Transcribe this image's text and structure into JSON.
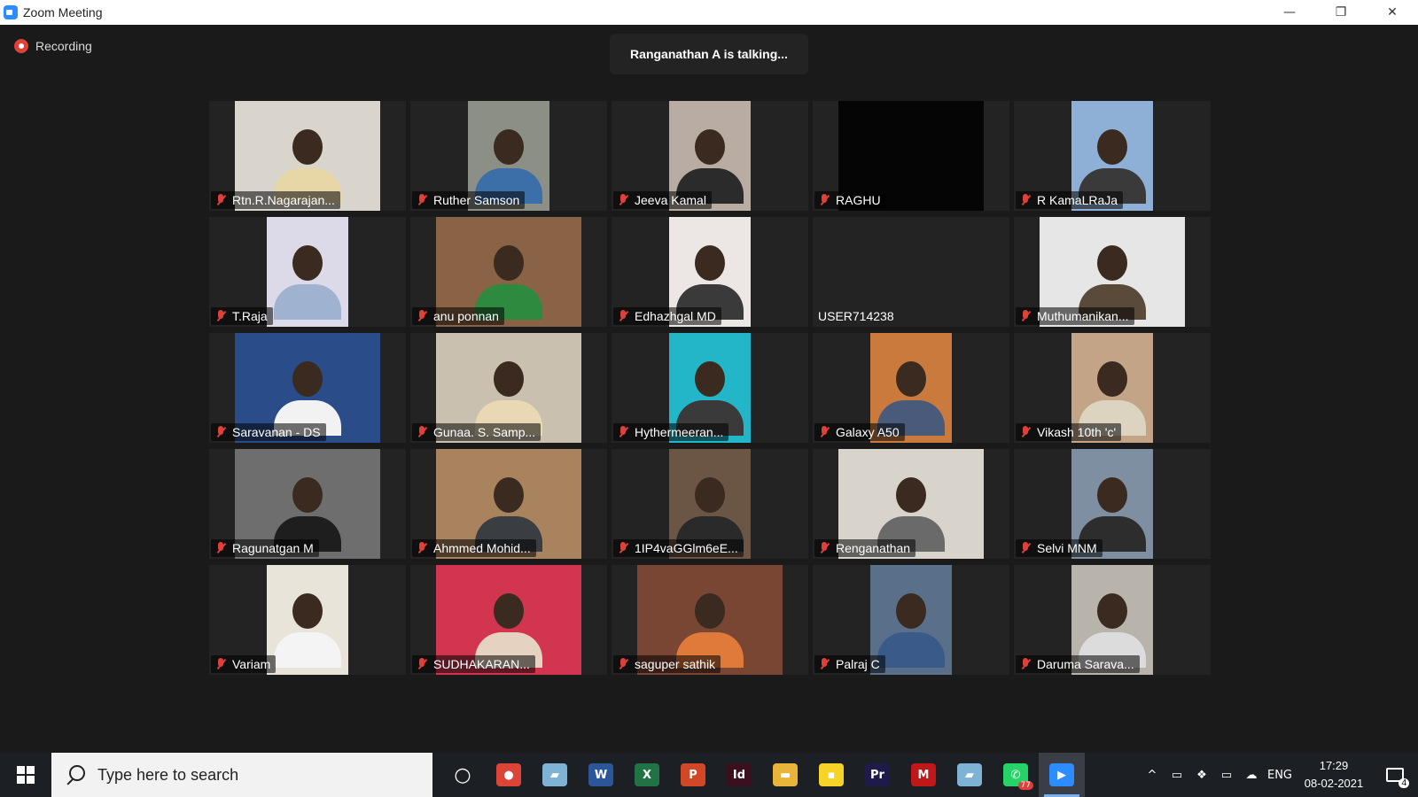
{
  "window": {
    "title": "Zoom Meeting",
    "minimize_glyph": "—",
    "restore_glyph": "❐",
    "close_glyph": "✕"
  },
  "meeting": {
    "recording_label": "Recording",
    "talking_banner": "Ranganathan A is talking...",
    "participants": [
      {
        "name": "Rtn.R.Nagarajan...",
        "muted": true,
        "video_bg": "#d9d4cc",
        "shirt": "#e8d7a6"
      },
      {
        "name": "Ruther Samson",
        "muted": true,
        "video_bg": "#8c8f86",
        "shirt": "#3c6fa8"
      },
      {
        "name": "Jeeva Kamal",
        "muted": true,
        "video_bg": "#b8aca3",
        "shirt": "#2b2b2b"
      },
      {
        "name": "RAGHU",
        "muted": true,
        "video_bg": "#050505",
        "shirt": "#1a1a1a"
      },
      {
        "name": "R KamaLRaJa",
        "muted": true,
        "video_bg": "#8fb0d6",
        "shirt": "#3a3a3a"
      },
      {
        "name": "T.Raja",
        "muted": true,
        "video_bg": "#dcd9e8",
        "shirt": "#9fb2d0"
      },
      {
        "name": "anu ponnan",
        "muted": true,
        "video_bg": "#8a6246",
        "shirt": "#2d8a3f"
      },
      {
        "name": "Edhazhgal MD",
        "muted": true,
        "video_bg": "#ece7e5",
        "shirt": "#3a3a3a"
      },
      {
        "name": "USER714238",
        "muted": false,
        "video_bg": "#232323",
        "shirt": "#232323"
      },
      {
        "name": "Muthumanikan...",
        "muted": true,
        "video_bg": "#e6e6e6",
        "shirt": "#5a4a3a"
      },
      {
        "name": "Saravanan - DS",
        "muted": true,
        "video_bg": "#2a4d8a",
        "shirt": "#f2f2f2"
      },
      {
        "name": "Gunaa. S. Samp...",
        "muted": true,
        "video_bg": "#c9c0b0",
        "shirt": "#e8d9b4"
      },
      {
        "name": "Hythermeeran...",
        "muted": true,
        "video_bg": "#23b6c9",
        "shirt": "#3a3a3a"
      },
      {
        "name": "Galaxy A50",
        "muted": true,
        "video_bg": "#c97a3c",
        "shirt": "#4a5a7a"
      },
      {
        "name": "Vikash 10th 'c'",
        "muted": true,
        "video_bg": "#c4a486",
        "shirt": "#dcd3c0"
      },
      {
        "name": "Ragunatgan M",
        "muted": true,
        "video_bg": "#6e6e6e",
        "shirt": "#1e1e1e"
      },
      {
        "name": "Ahmmed Mohid...",
        "muted": true,
        "video_bg": "#a9825e",
        "shirt": "#3a3d42"
      },
      {
        "name": "1IP4vaGGlm6eE...",
        "muted": true,
        "video_bg": "#6b5645",
        "shirt": "#2a2a2a"
      },
      {
        "name": "Renganathan",
        "muted": true,
        "video_bg": "#d8d4cc",
        "shirt": "#6a6a6a"
      },
      {
        "name": "Selvi MNM",
        "muted": true,
        "video_bg": "#7d8fa0",
        "shirt": "#2d2d2d"
      },
      {
        "name": "Variam",
        "muted": true,
        "video_bg": "#e9e4da",
        "shirt": "#f4f4f4"
      },
      {
        "name": "SUDHAKARAN...",
        "muted": true,
        "video_bg": "#d2364e",
        "shirt": "#e6d2c0"
      },
      {
        "name": "saguper sathik",
        "muted": true,
        "video_bg": "#7a4634",
        "shirt": "#e07a3a"
      },
      {
        "name": "Palraj C",
        "muted": true,
        "video_bg": "#5a6f8a",
        "shirt": "#3a5a8a"
      },
      {
        "name": "Daruma Sarava...",
        "muted": true,
        "video_bg": "#b8b4ac",
        "shirt": "#dcdcdc"
      }
    ]
  },
  "taskbar": {
    "search_placeholder": "Type here to search",
    "apps": [
      {
        "name": "cortana-icon",
        "glyph": "○",
        "color": "transparent"
      },
      {
        "name": "chrome-icon",
        "glyph": "●",
        "color": "#db4437"
      },
      {
        "name": "app-icon",
        "glyph": "▰",
        "color": "#7fb3d5"
      },
      {
        "name": "word-icon",
        "glyph": "W",
        "color": "#2b579a"
      },
      {
        "name": "excel-icon",
        "glyph": "X",
        "color": "#217346"
      },
      {
        "name": "powerpoint-icon",
        "glyph": "P",
        "color": "#d24726"
      },
      {
        "name": "indesign-icon",
        "glyph": "Id",
        "color": "#3a0f1e"
      },
      {
        "name": "file-explorer-icon",
        "glyph": "▬",
        "color": "#e8b53a"
      },
      {
        "name": "sticky-notes-icon",
        "glyph": "▪",
        "color": "#f5d327"
      },
      {
        "name": "premiere-icon",
        "glyph": "Pr",
        "color": "#1e1a4a"
      },
      {
        "name": "mcafee-icon",
        "glyph": "M",
        "color": "#c01818"
      },
      {
        "name": "app2-icon",
        "glyph": "▰",
        "color": "#7fb3d5"
      },
      {
        "name": "whatsapp-icon",
        "glyph": "✆",
        "color": "#25d366",
        "badge": "77"
      },
      {
        "name": "zoom-icon",
        "glyph": "▶",
        "color": "#2d8cff",
        "active": true
      }
    ],
    "tray": {
      "chevron": "^",
      "language": "ENG",
      "time": "17:29",
      "date": "08-02-2021",
      "notification_count": "4"
    }
  }
}
